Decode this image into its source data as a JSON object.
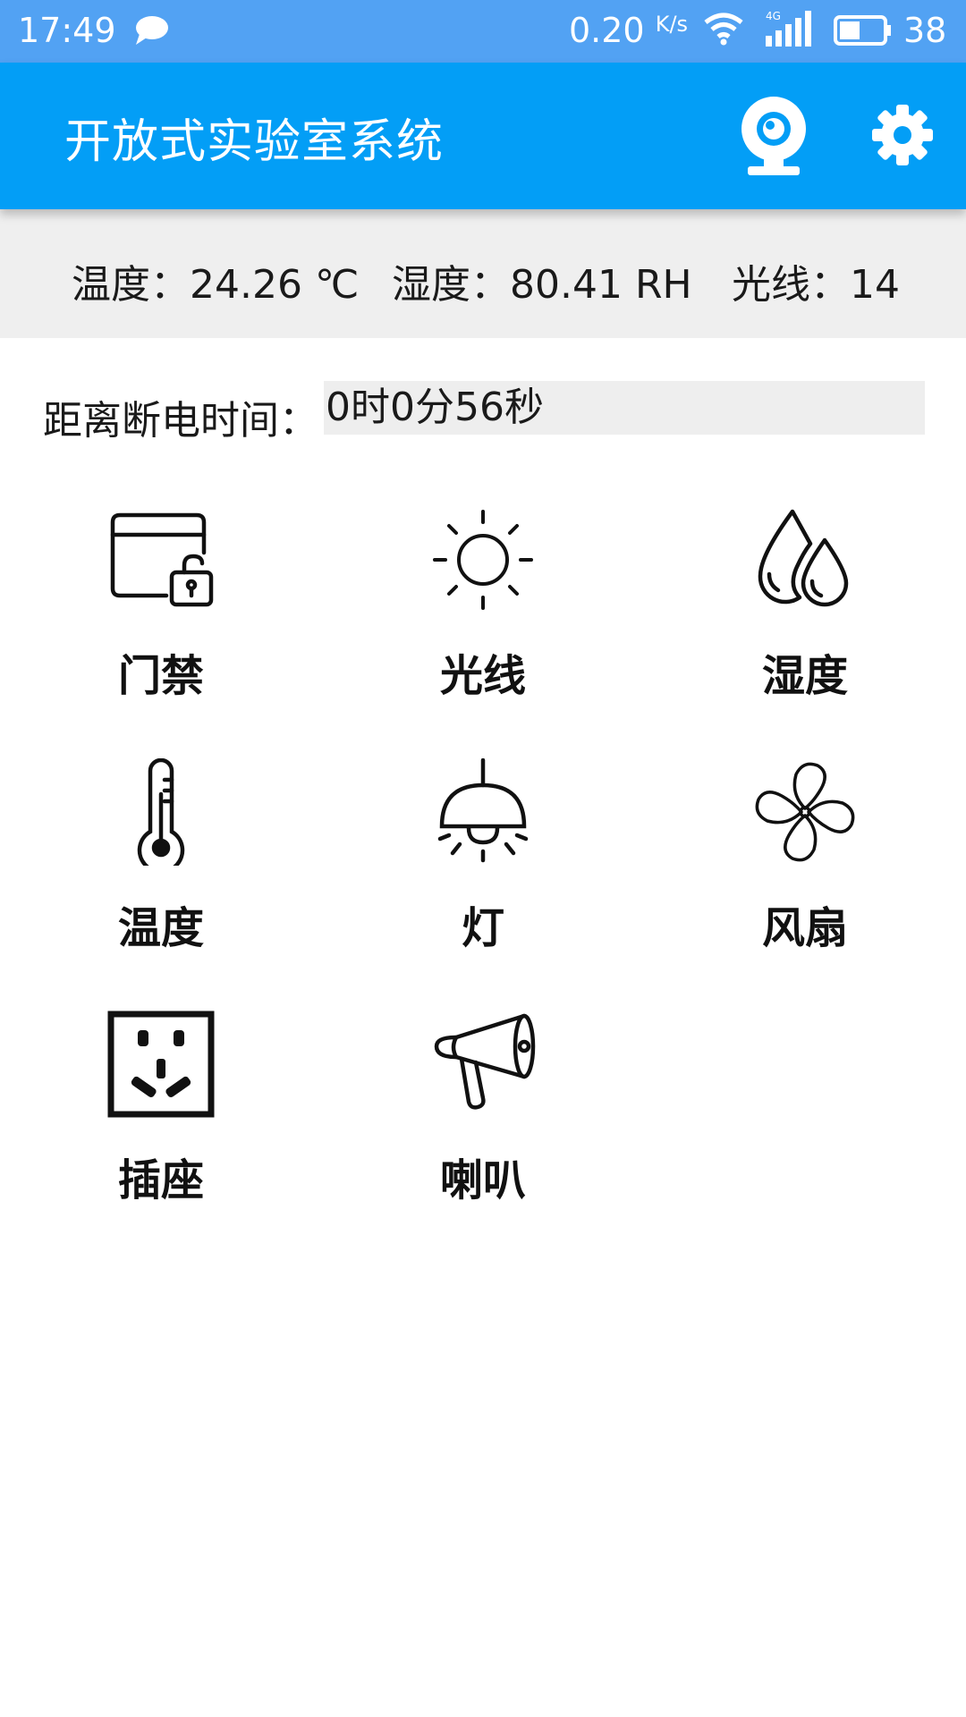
{
  "status_bar": {
    "time": "17:49",
    "net_speed": "0.20",
    "net_unit": "K/s",
    "network": "4G",
    "battery": "38",
    "icons": [
      "message-icon",
      "wifi-icon",
      "signal-icon",
      "battery-icon"
    ]
  },
  "app_bar": {
    "title": "开放式实验室系统",
    "actions": [
      "camera-icon",
      "gear-icon"
    ],
    "color": "#039ef6"
  },
  "sensors": {
    "temperature": "温度：24.26 ℃",
    "humidity": "湿度：80.41 RH",
    "light": "光线：14"
  },
  "countdown": {
    "label": "距离断电时间：",
    "value": "0时0分56秒"
  },
  "grid": [
    {
      "label": "门禁",
      "icon": "card-lock-icon"
    },
    {
      "label": "光线",
      "icon": "sun-icon"
    },
    {
      "label": "湿度",
      "icon": "droplets-icon"
    },
    {
      "label": "温度",
      "icon": "thermometer-icon"
    },
    {
      "label": "灯",
      "icon": "lamp-icon"
    },
    {
      "label": "风扇",
      "icon": "fan-icon"
    },
    {
      "label": "插座",
      "icon": "socket-icon"
    },
    {
      "label": "喇叭",
      "icon": "megaphone-icon"
    }
  ]
}
